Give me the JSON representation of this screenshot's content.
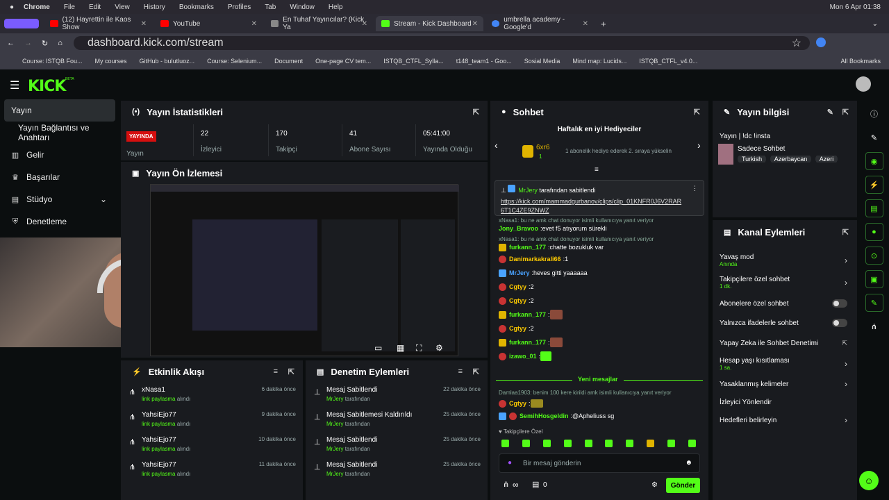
{
  "menubar": {
    "app": "Chrome",
    "items": [
      "File",
      "Edit",
      "View",
      "History",
      "Bookmarks",
      "Profiles",
      "Tab",
      "Window",
      "Help"
    ],
    "clock": "Mon 6 Apr  01:38"
  },
  "tabs": [
    {
      "title": "(12) Hayrettin ile Kaos Show",
      "color": "#ff0000"
    },
    {
      "title": "YouTube",
      "color": "#ff0000"
    },
    {
      "title": "En Tuhaf Yayıncılar? (Kick Ya",
      "color": "#888888"
    },
    {
      "title": "Stream - Kick Dashboard",
      "color": "#53fc18"
    },
    {
      "title": "umbrella academy - Google'd",
      "color": "#4285f4"
    }
  ],
  "address": {
    "url": "dashboard.kick.com/stream"
  },
  "bookmarks": [
    "Course: ISTQB Fou...",
    "My courses",
    "GitHub - bulutluoz...",
    "Course: Selenium...",
    "Document",
    "One-page CV tem...",
    "ISTQB_CTFL_Sylla...",
    "t148_team1 - Goo...",
    "Sosial Media",
    "Mind map: Lucids...",
    "ISTQB_CTFL_v4.0...",
    "All Bookmarks"
  ],
  "logo": "KICK",
  "logo_beta": "BETA",
  "sidebar": {
    "items": [
      {
        "label": "Yayın",
        "icon": "video-icon"
      },
      {
        "label": "Yayın Bağlantısı ve Anahtarı",
        "icon": ""
      },
      {
        "label": "Gelir",
        "icon": "chart-icon"
      },
      {
        "label": "Başarılar",
        "icon": "trophy-icon"
      },
      {
        "label": "Stüdyo",
        "icon": "studio-icon"
      },
      {
        "label": "Denetleme",
        "icon": "shield-icon"
      }
    ]
  },
  "stats": {
    "title": "Yayın İstatistikleri",
    "live_badge": "YAYINDA",
    "live_label": "Yayın",
    "items": [
      {
        "value": "22",
        "label": "İzleyici"
      },
      {
        "value": "170",
        "label": "Takipçi"
      },
      {
        "value": "41",
        "label": "Abone Sayısı"
      },
      {
        "value": "05:41:00",
        "label": "Yayında Olduğu"
      }
    ]
  },
  "preview": {
    "title": "Yayın Ön İzlemesi"
  },
  "activity": {
    "title": "Etkinlik Akışı",
    "items": [
      {
        "user": "xNasa1",
        "action": "link paylasma",
        "suffix": "alındı",
        "time": "6 dakika önce"
      },
      {
        "user": "YahsiEjo77",
        "action": "link paylasma",
        "suffix": "alındı",
        "time": "9 dakika önce"
      },
      {
        "user": "YahsiEjo77",
        "action": "link paylasma",
        "suffix": "alındı",
        "time": "10 dakika önce"
      },
      {
        "user": "YahsiEjo77",
        "action": "link paylasma",
        "suffix": "alındı",
        "time": "11 dakika önce"
      }
    ]
  },
  "moderation": {
    "title": "Denetim Eylemleri",
    "items": [
      {
        "action": "Mesaj Sabitlendi",
        "by": "MrJery",
        "suffix": "tarafından",
        "time": "22 dakika önce"
      },
      {
        "action": "Mesaj Sabitlemesi Kaldırıldı",
        "by": "MrJery",
        "suffix": "tarafından",
        "time": "25 dakika önce"
      },
      {
        "action": "Mesaj Sabitlendi",
        "by": "MrJery",
        "suffix": "tarafından",
        "time": "25 dakika önce"
      },
      {
        "action": "Mesaj Sabitlendi",
        "by": "MrJery",
        "suffix": "tarafından",
        "time": "25 dakika önce"
      }
    ]
  },
  "chat": {
    "title": "Sohbet",
    "gifters_title": "Haftalık en iyi Hediyeciler",
    "gifter_name": "6xr6",
    "gifter_count": "1",
    "gifter_note": "1 abonelik hediye ederek 2. sıraya yükselin",
    "pinned_by": "MrJery",
    "pinned_suffix": "tarafından sabitlendi",
    "pinned_link": "https://kick.com/mammadgurbanov/clips/clip_01KNFR0J6V2RAR6T1C4ZE9ZNWZ",
    "messages": [
      {
        "reply": "xNasa1: bu ne amk chat donuyor isimli kullanıcıya yanıt veriyor",
        "user": "Jony_Bravoo",
        "color": "#53fc18",
        "text": "evet f5 atıyorum sürekli"
      },
      {
        "reply": "xNasa1: bu ne amk chat donuyor isimli kullanıcıya yanıt veriyor",
        "user": "furkann_177",
        "color": "#53fc18",
        "text": "chatte bozukluk var"
      },
      {
        "reply": "",
        "user": "Danimarkakrali66",
        "color": "#ffcc00",
        "text": "1"
      },
      {
        "reply": "",
        "user": "MrJery",
        "color": "#4aa3ff",
        "text": "heves gitti yaaaaaa"
      },
      {
        "reply": "",
        "user": "Cgtyy",
        "color": "#ffcc00",
        "text": "2"
      },
      {
        "reply": "",
        "user": "Cgtyy",
        "color": "#ffcc00",
        "text": "2"
      },
      {
        "reply": "",
        "user": "furkann_177",
        "color": "#53fc18",
        "text": ""
      },
      {
        "reply": "",
        "user": "Cgtyy",
        "color": "#ffcc00",
        "text": "2"
      },
      {
        "reply": "",
        "user": "furkann_177",
        "color": "#53fc18",
        "text": ""
      },
      {
        "reply": "",
        "user": "izawo_01",
        "color": "#53fc18",
        "text": ""
      }
    ],
    "new_messages": "Yeni mesajlar",
    "after": [
      {
        "reply": "Damlaa1903: benim 100 kere kirildi amk isimli kullanıcıya yanıt veriyor",
        "user": "Cgtyy",
        "color": "#ffcc00",
        "text": ""
      },
      {
        "reply": "",
        "user": "SemihHosgeldin",
        "color": "#53fc18",
        "text": "@Apheliuss sg"
      }
    ],
    "followers_only": "Takipçilere Özel",
    "input_placeholder": "Bir mesaj gönderin",
    "points": "∞",
    "count": "0",
    "send": "Gönder"
  },
  "info": {
    "title": "Yayın bilgisi",
    "stream_title": "Yayın | !dc !insta",
    "category": "Sadece Sohbet",
    "tags": [
      "Turkish",
      "Azerbaycan",
      "Azeri"
    ]
  },
  "channel": {
    "title": "Kanal Eylemleri",
    "items": [
      {
        "label": "Yavaş mod",
        "sub": "Anında",
        "kind": "chev"
      },
      {
        "label": "Takipçilere özel sohbet",
        "sub": "1 dk.",
        "kind": "chev"
      },
      {
        "label": "Abonelere özel sohbet",
        "sub": "",
        "kind": "toggle"
      },
      {
        "label": "Yalnızca ifadelerle sohbet",
        "sub": "",
        "kind": "toggle"
      },
      {
        "label": "Yapay Zeka ile Sohbet Denetimi",
        "sub": "",
        "kind": "ext"
      },
      {
        "label": "Hesap yaşı kısıtlaması",
        "sub": "1 sa.",
        "kind": "chev"
      },
      {
        "label": "Yasaklanmış kelimeler",
        "sub": "",
        "kind": "chev"
      },
      {
        "label": "İzleyici Yönlendir",
        "sub": "",
        "kind": "none"
      },
      {
        "label": "Hedefleri belirleyin",
        "sub": "",
        "kind": "chev"
      }
    ]
  }
}
